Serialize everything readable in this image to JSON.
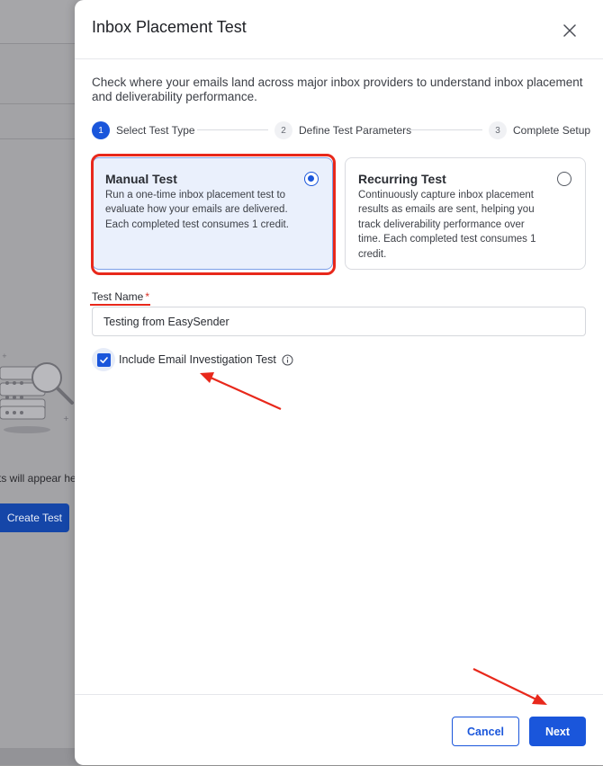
{
  "background": {
    "empty_state_text": "ts will appear her",
    "create_button_label": "Create Test"
  },
  "modal": {
    "title": "Inbox Placement Test",
    "description": "Check where your emails land across major inbox providers to understand inbox placement and deliverability performance.",
    "steps": [
      {
        "number": "1",
        "label": "Select Test Type",
        "active": true
      },
      {
        "number": "2",
        "label": "Define Test Parameters",
        "active": false
      },
      {
        "number": "3",
        "label": "Complete Setup",
        "active": false
      }
    ],
    "options": [
      {
        "title": "Manual Test",
        "description": "Run a one-time inbox placement test to evaluate how your emails are delivered. Each completed test consumes 1 credit.",
        "selected": true
      },
      {
        "title": "Recurring Test",
        "description": "Continuously capture inbox placement results as emails are sent, helping you track deliverability performance over time. Each completed test consumes 1 credit.",
        "selected": false
      }
    ],
    "test_name": {
      "label": "Test Name",
      "required_mark": "*",
      "value": "Testing from EasySender"
    },
    "investigation_checkbox": {
      "label": "Include Email Investigation Test",
      "checked": true
    },
    "footer": {
      "cancel_label": "Cancel",
      "next_label": "Next"
    }
  },
  "colors": {
    "accent": "#1a56db",
    "annotation": "#e8281b"
  }
}
